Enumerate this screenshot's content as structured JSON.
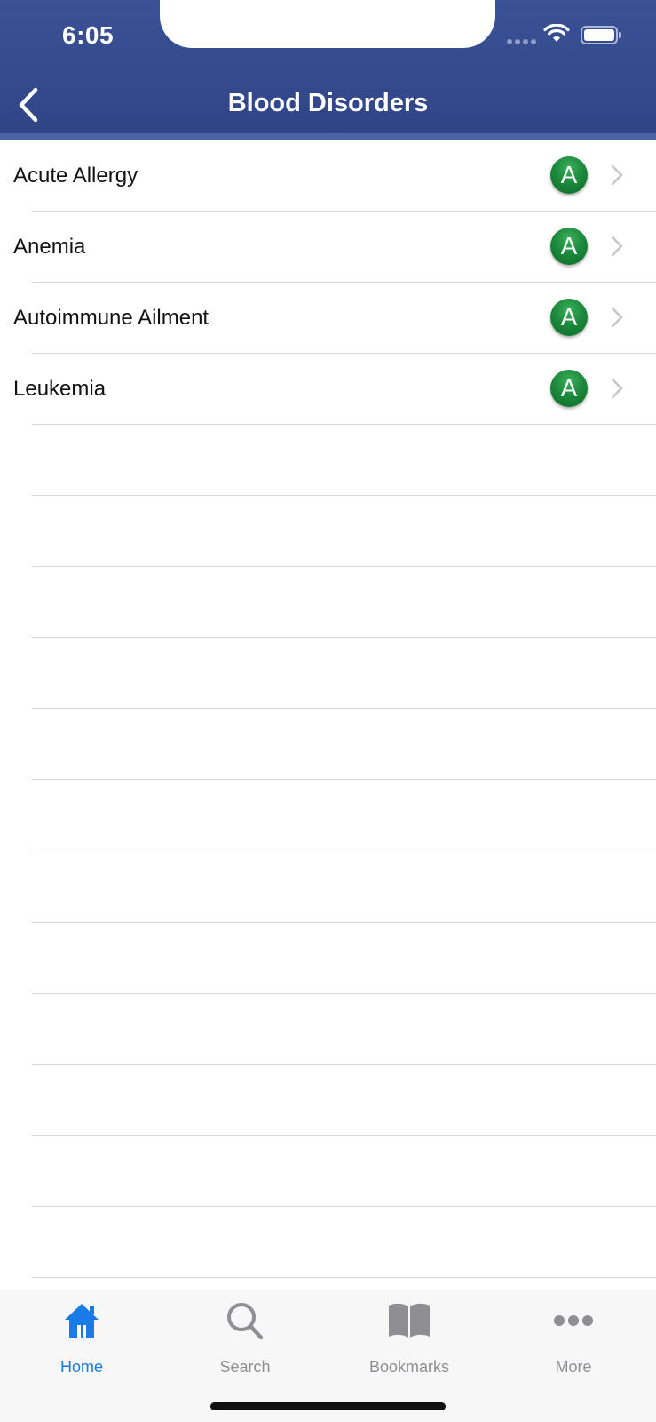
{
  "status_bar": {
    "time": "6:05"
  },
  "nav": {
    "title": "Blood Disorders",
    "back_icon": "chevron-left-icon"
  },
  "list": {
    "items": [
      {
        "label": "Acute Allergy",
        "badge": "A"
      },
      {
        "label": "Anemia",
        "badge": "A"
      },
      {
        "label": "Autoimmune Ailment",
        "badge": "A"
      },
      {
        "label": "Leukemia",
        "badge": "A"
      }
    ],
    "badge_color": "#1c8a3c"
  },
  "tabbar": {
    "tabs": [
      {
        "label": "Home",
        "icon": "home-icon",
        "active": true
      },
      {
        "label": "Search",
        "icon": "search-icon",
        "active": false
      },
      {
        "label": "Bookmarks",
        "icon": "book-icon",
        "active": false
      },
      {
        "label": "More",
        "icon": "more-icon",
        "active": false
      }
    ],
    "active_color": "#1a7ae8",
    "inactive_color": "#8e8e93"
  },
  "colors": {
    "header": "#34498c"
  }
}
